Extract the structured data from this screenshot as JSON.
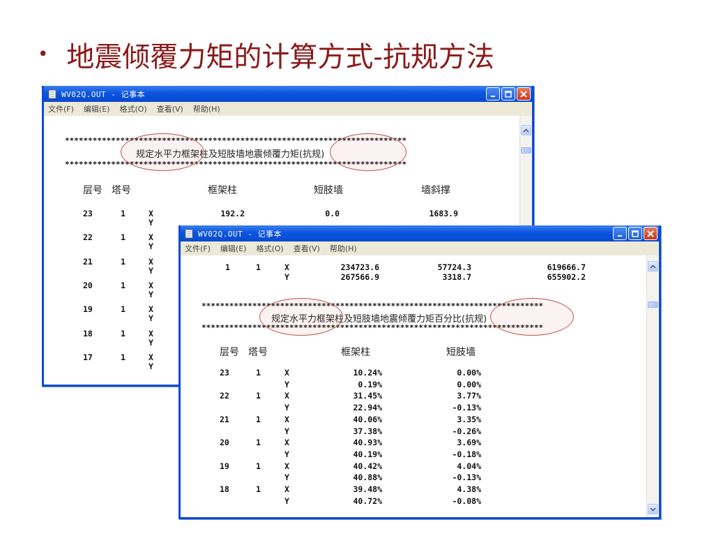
{
  "slide": {
    "bullet": "•",
    "title": "地震倾覆力矩的计算方式-抗规方法"
  },
  "window1": {
    "title": "WV02Q.OUT - 记事本",
    "menu": [
      "文件(F)",
      "编辑(E)",
      "格式(O)",
      "查看(V)",
      "帮助(H)"
    ],
    "stars": "**************************************************************************",
    "heading": "规定水平力框架柱及短肢墙地震倾覆力矩(抗规)",
    "columns": [
      "层号",
      "塔号",
      "框架柱",
      "短肢墙",
      "墙斜撑"
    ],
    "rows": [
      {
        "floor": "23",
        "tower": "1",
        "dirs": [
          "X",
          "Y"
        ],
        "frame": [
          "192.2",
          ""
        ],
        "short": [
          "0.0",
          ""
        ],
        "brace": [
          "1683.9",
          ""
        ]
      },
      {
        "floor": "22",
        "tower": "1",
        "dirs": [
          "X",
          "Y"
        ]
      },
      {
        "floor": "21",
        "tower": "1",
        "dirs": [
          "X",
          "Y"
        ]
      },
      {
        "floor": "20",
        "tower": "1",
        "dirs": [
          "X",
          "Y"
        ]
      },
      {
        "floor": "19",
        "tower": "1",
        "dirs": [
          "X",
          "Y"
        ]
      },
      {
        "floor": "18",
        "tower": "1",
        "dirs": [
          "X",
          "Y"
        ]
      },
      {
        "floor": "17",
        "tower": "1",
        "dirs": [
          "X",
          "Y"
        ]
      }
    ]
  },
  "window2": {
    "title": "WV02Q.OUT - 记事本",
    "menu": [
      "文件(F)",
      "编辑(E)",
      "格式(O)",
      "查看(V)",
      "帮助(H)"
    ],
    "top_rows": [
      {
        "floor": "1",
        "tower": "1",
        "dir": "X",
        "a": "234723.6",
        "b": "57724.3",
        "c": "619666.7"
      },
      {
        "floor": "",
        "tower": "",
        "dir": "Y",
        "a": "267566.9",
        "b": "3318.7",
        "c": "655902.2"
      }
    ],
    "stars": "**************************************************************************",
    "heading": "规定水平力框架柱及短肢墙地震倾覆力矩百分比(抗规)",
    "columns": [
      "层号",
      "塔号",
      "框架柱",
      "短肢墙"
    ],
    "rows": [
      {
        "floor": "23",
        "tower": "1",
        "dir": "X",
        "frame": "10.24%",
        "short": "0.00%"
      },
      {
        "floor": "",
        "tower": "",
        "dir": "Y",
        "frame": "0.19%",
        "short": "0.00%"
      },
      {
        "floor": "22",
        "tower": "1",
        "dir": "X",
        "frame": "31.45%",
        "short": "3.77%"
      },
      {
        "floor": "",
        "tower": "",
        "dir": "Y",
        "frame": "22.94%",
        "short": "-0.13%"
      },
      {
        "floor": "21",
        "tower": "1",
        "dir": "X",
        "frame": "40.06%",
        "short": "3.35%"
      },
      {
        "floor": "",
        "tower": "",
        "dir": "Y",
        "frame": "37.38%",
        "short": "-0.26%"
      },
      {
        "floor": "20",
        "tower": "1",
        "dir": "X",
        "frame": "40.93%",
        "short": "3.69%"
      },
      {
        "floor": "",
        "tower": "",
        "dir": "Y",
        "frame": "40.19%",
        "short": "-0.18%"
      },
      {
        "floor": "19",
        "tower": "1",
        "dir": "X",
        "frame": "40.42%",
        "short": "4.04%"
      },
      {
        "floor": "",
        "tower": "",
        "dir": "Y",
        "frame": "40.88%",
        "short": "-0.13%"
      },
      {
        "floor": "18",
        "tower": "1",
        "dir": "X",
        "frame": "39.48%",
        "short": "4.38%"
      },
      {
        "floor": "",
        "tower": "",
        "dir": "Y",
        "frame": "40.72%",
        "short": "-0.08%"
      }
    ]
  },
  "colors": {
    "title": "#8b1a1a",
    "highlight_ellipse": "#c0504d",
    "titlebar": "#0a55e0"
  }
}
